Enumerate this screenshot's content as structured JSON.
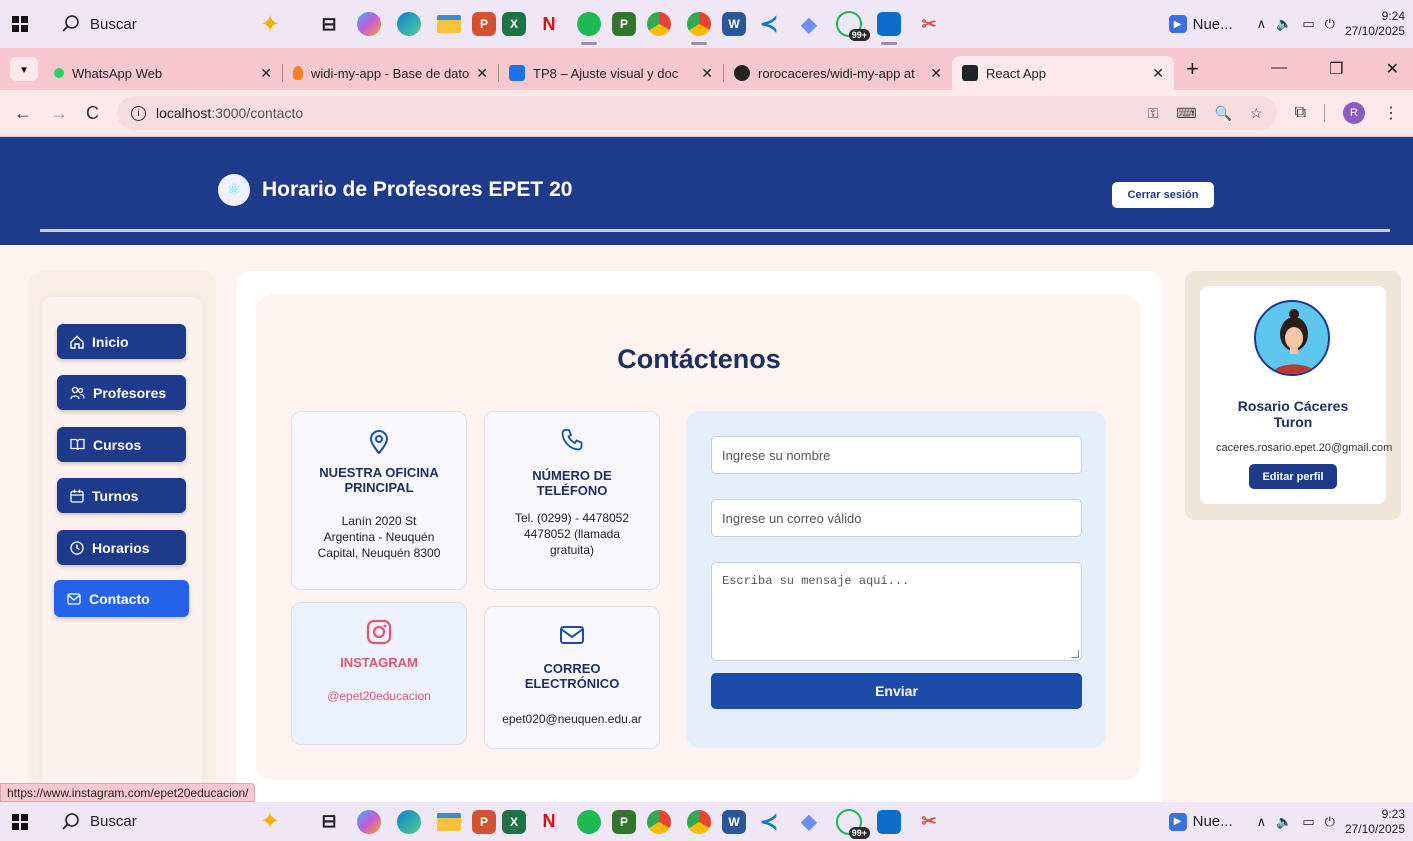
{
  "taskbar": {
    "search_label": "Buscar",
    "nue_label": "Nue...",
    "time_top": "9:24",
    "date_top": "27/10/2025",
    "time_bottom": "9:23",
    "date_bottom": "27/10/2025",
    "whatsapp_badge": "99+",
    "apps": [
      "task-view",
      "copilot",
      "edge",
      "file-explorer",
      "powerpoint",
      "excel",
      "netflix",
      "spotify",
      "project",
      "chrome",
      "chrome-profile",
      "word",
      "vscode",
      "gemini",
      "whatsapp",
      "teamviewer",
      "snipping"
    ]
  },
  "browser": {
    "tabs": [
      {
        "title": "WhatsApp Web",
        "favicon_color": "#25d366"
      },
      {
        "title": "widi-my-app - Base de datos",
        "favicon_color": "#f58220"
      },
      {
        "title": "TP8 – Ajuste visual y doc",
        "favicon_color": "#1a73e8"
      },
      {
        "title": "rorocaceres/widi-my-app at",
        "favicon_color": "#222222"
      },
      {
        "title": "React App",
        "favicon_color": "#20232a"
      }
    ],
    "url_host": "localhost",
    "url_path": ":3000/contacto",
    "profile_initial": "R",
    "status_url": "https://www.instagram.com/epet20educacion/"
  },
  "header": {
    "title": "Horario de Profesores EPET 20",
    "logout_label": "Cerrar sesión"
  },
  "sidebar": {
    "items": [
      {
        "label": "Inicio",
        "icon": "home-icon"
      },
      {
        "label": "Profesores",
        "icon": "users-icon"
      },
      {
        "label": "Cursos",
        "icon": "book-icon"
      },
      {
        "label": "Turnos",
        "icon": "calendar-icon"
      },
      {
        "label": "Horarios",
        "icon": "clock-icon"
      },
      {
        "label": "Contacto",
        "icon": "mail-icon",
        "active": true
      }
    ]
  },
  "contact": {
    "title": "Contáctenos",
    "office": {
      "heading": "NUESTRA OFICINA PRINCIPAL",
      "line1": "Lanín 2020 St",
      "line2": "Argentina - Neuquén",
      "line3": "Capital, Neuquén 8300"
    },
    "phone": {
      "heading": "NÚMERO DE TELÉFONO",
      "line1": "Tel. (0299) - 4478052",
      "line2": "4478052 (llamada",
      "line3": "gratuita)"
    },
    "instagram": {
      "heading": "INSTAGRAM",
      "handle": "@epet20educacion"
    },
    "email": {
      "heading": "CORREO ELECTRÓNICO",
      "address": "epet020@neuquen.edu.ar"
    },
    "form": {
      "name_placeholder": "Ingrese su nombre",
      "email_placeholder": "Ingrese un correo válido",
      "message_placeholder": "Escriba su mensaje aquí...",
      "submit_label": "Enviar"
    }
  },
  "profile": {
    "name_line1": "Rosario Cáceres",
    "name_line2": "Turon",
    "email": "caceres.rosario.epet.20@gmail.com",
    "edit_label": "Editar perfil"
  },
  "colors": {
    "header_bg": "#1e3a8a",
    "sidebar_button": "#1e3a8a",
    "sidebar_active": "#2563eb",
    "instagram": "#e2566f"
  }
}
